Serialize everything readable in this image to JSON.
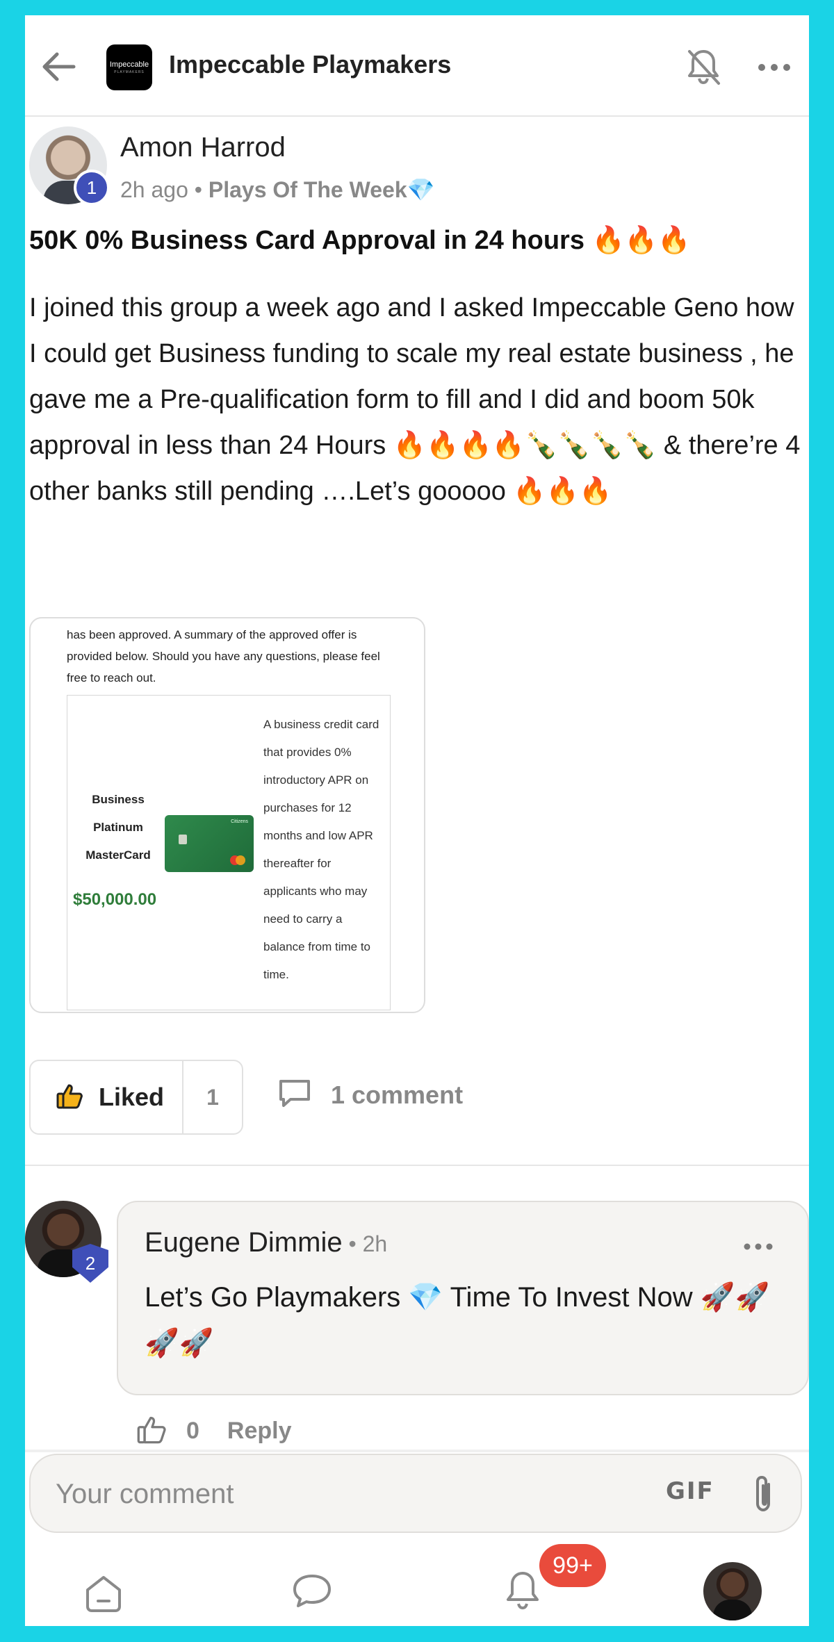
{
  "colors": {
    "frame": "#1ad3e6",
    "badge_blue": "#3f4fb8",
    "notif_red": "#e94b3c"
  },
  "header": {
    "logo_text": "Impeccable",
    "logo_subtext": "PLAYMAKERS",
    "group_name": "Impeccable Playmakers",
    "icons": [
      "back-arrow-icon",
      "bell-off-icon",
      "more-dots-icon"
    ]
  },
  "post": {
    "author": "Amon Harrod",
    "author_level": "1",
    "time": "2h ago",
    "meta_sep": " • ",
    "category": "Plays Of The Week💎",
    "title": "50K 0% Business Card Approval in 24 hours 🔥🔥🔥",
    "body": "I joined this group a week ago and I asked Impeccable Geno how I could get Business funding to scale my real estate business , he gave me a Pre-qualification form to fill and I did and boom 50k approval in less than 24 Hours 🔥🔥🔥🔥🍾🍾🍾🍾 & there’re 4 other banks still pending ….Let’s gooooo 🔥🔥🔥",
    "attachment": {
      "intro": "has been approved. A summary of the approved offer is provided below. Should you have any questions, please feel free to reach out.",
      "card_name": "Business Platinum MasterCard",
      "amount": "$50,000.00",
      "card_brand": "Citizens",
      "description": "A business credit card that provides 0% introductory APR on purchases for 12 months and low APR thereafter for applicants who may need to carry a balance from time to time."
    },
    "like_label": "Liked",
    "like_count": "1",
    "comment_label": "1 comment"
  },
  "comment": {
    "author": "Eugene Dimmie",
    "author_level": "2",
    "time": " • 2h",
    "text": "Let’s Go Playmakers 💎 Time To Invest Now 🚀🚀🚀🚀",
    "like_count": "0",
    "reply_label": "Reply"
  },
  "composer": {
    "placeholder": "Your comment",
    "gif_label": "GIF"
  },
  "nav": {
    "notifications_badge": "99+",
    "items": [
      "home-icon",
      "chat-icon",
      "bell-icon",
      "profile-avatar"
    ]
  }
}
